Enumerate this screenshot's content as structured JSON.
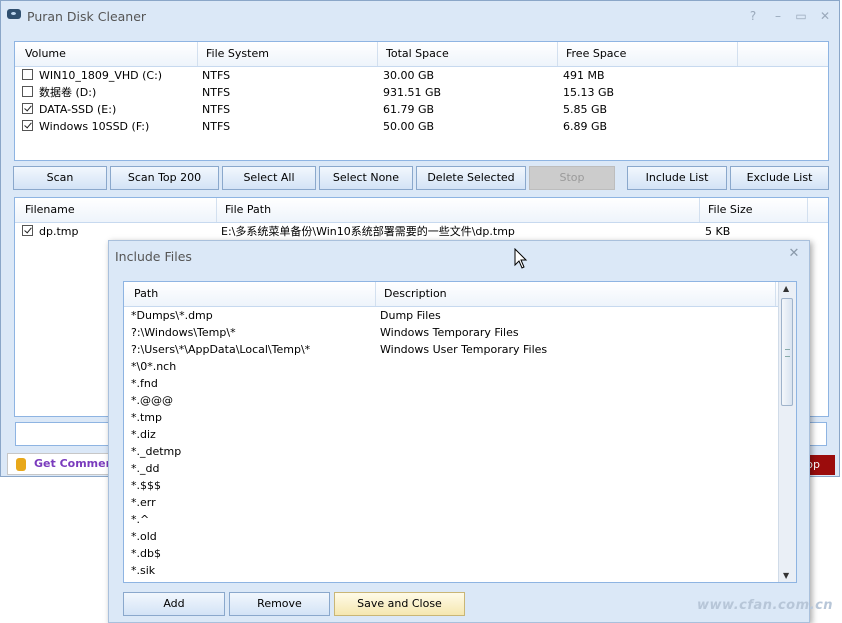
{
  "window": {
    "title": "Puran Disk Cleaner",
    "controls": {
      "help": "?",
      "minimize": "–",
      "maximize": "▭",
      "close": "✕"
    }
  },
  "volumes": {
    "columns": [
      "Volume",
      "File System",
      "Total Space",
      "Free Space"
    ],
    "rows": [
      {
        "checked": false,
        "name": "WIN10_1809_VHD (C:)",
        "fs": "NTFS",
        "total": "30.00 GB",
        "free": "491 MB"
      },
      {
        "checked": false,
        "name": "数据卷 (D:)",
        "fs": "NTFS",
        "total": "931.51 GB",
        "free": "15.13 GB"
      },
      {
        "checked": true,
        "name": "DATA-SSD (E:)",
        "fs": "NTFS",
        "total": "61.79 GB",
        "free": "5.85 GB"
      },
      {
        "checked": true,
        "name": "Windows 10SSD (F:)",
        "fs": "NTFS",
        "total": "50.00 GB",
        "free": "6.89 GB"
      }
    ]
  },
  "toolbar": {
    "scan": "Scan",
    "scan_top": "Scan Top 200",
    "select_all": "Select All",
    "select_none": "Select None",
    "delete_selected": "Delete Selected",
    "stop": "Stop",
    "include_list": "Include List",
    "exclude_list": "Exclude List"
  },
  "results": {
    "columns": [
      "Filename",
      "File Path",
      "File Size"
    ],
    "rows": [
      {
        "checked": true,
        "name": "dp.tmp",
        "path": "E:\\多系统菜单备份\\Win10系统部署需要的一些文件\\dp.tmp",
        "size": "5 KB"
      }
    ]
  },
  "commercial": {
    "label": "Get Commerci"
  },
  "corner_button": {
    "label": "pp"
  },
  "dialog": {
    "title": "Include Files",
    "close": "✕",
    "columns": [
      "Path",
      "Description"
    ],
    "rows": [
      {
        "path": "*Dumps\\*.dmp",
        "desc": "Dump Files"
      },
      {
        "path": "?:\\Windows\\Temp\\*",
        "desc": "Windows Temporary Files"
      },
      {
        "path": "?:\\Users\\*\\AppData\\Local\\Temp\\*",
        "desc": "Windows User Temporary Files"
      },
      {
        "path": "*\\0*.nch",
        "desc": ""
      },
      {
        "path": "*.fnd",
        "desc": ""
      },
      {
        "path": "*.@@@",
        "desc": ""
      },
      {
        "path": "*.tmp",
        "desc": ""
      },
      {
        "path": "*.diz",
        "desc": ""
      },
      {
        "path": "*._detmp",
        "desc": ""
      },
      {
        "path": "*._dd",
        "desc": ""
      },
      {
        "path": "*.$$$",
        "desc": ""
      },
      {
        "path": "*.err",
        "desc": ""
      },
      {
        "path": "*.^",
        "desc": ""
      },
      {
        "path": "*.old",
        "desc": ""
      },
      {
        "path": "*.db$",
        "desc": ""
      },
      {
        "path": "*.sik",
        "desc": ""
      }
    ],
    "buttons": {
      "add": "Add",
      "remove": "Remove",
      "save_close": "Save and Close"
    }
  },
  "watermark": "www.cfan.com.cn"
}
